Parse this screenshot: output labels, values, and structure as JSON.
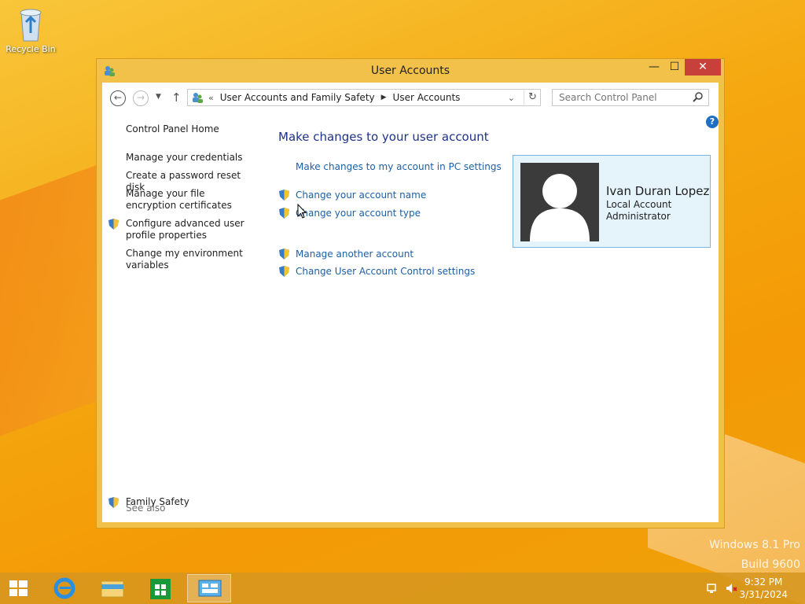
{
  "desktop": {
    "recycle_bin_label": "Recycle Bin"
  },
  "window": {
    "title": "User Accounts",
    "controls": {
      "minimize": "—",
      "maximize": "☐",
      "close": "✕"
    }
  },
  "address_bar": {
    "separator": "«",
    "breadcrumbs": [
      "User Accounts and Family Safety",
      "User Accounts"
    ],
    "search_placeholder": "Search Control Panel"
  },
  "help_glyph": "?",
  "left_pane": {
    "home": "Control Panel Home",
    "items": [
      "Manage your credentials",
      "Create a password reset disk",
      "Manage your file encryption certificates",
      "Configure advanced user profile properties",
      "Change my environment variables"
    ],
    "see_also_heading": "See also",
    "see_also_items": [
      "Family Safety"
    ]
  },
  "main": {
    "title": "Make changes to your user account",
    "links": [
      "Make changes to my account in PC settings",
      "Change your account name",
      "Change your account type",
      "Manage another account",
      "Change User Account Control settings"
    ]
  },
  "account": {
    "name": "Ivan Duran Lopez",
    "type": "Local Account",
    "role": "Administrator"
  },
  "watermark": {
    "line1": "Windows 8.1 Pro",
    "line2": "Build 9600"
  },
  "taskbar": {
    "time": "9:32 PM",
    "date": "3/31/2024"
  },
  "colors": {
    "accent": "#f2c14a",
    "link": "#1b5fa8",
    "title": "#1e3287",
    "close": "#c7403a"
  }
}
